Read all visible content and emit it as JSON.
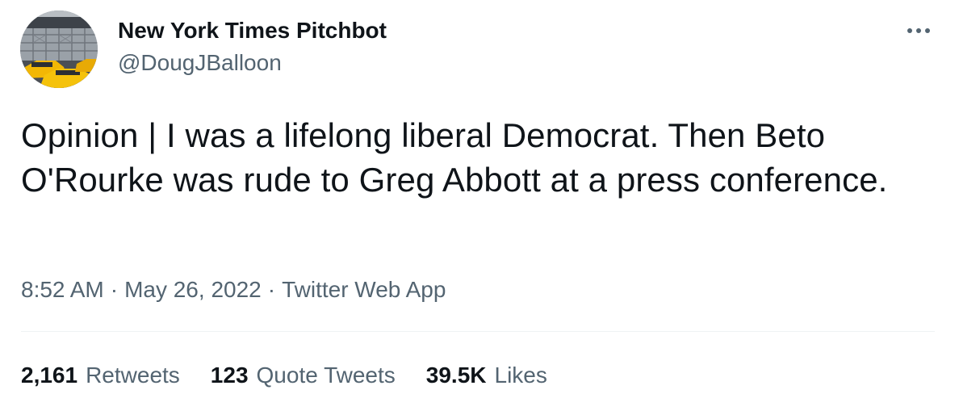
{
  "tweet": {
    "author": {
      "name": "New York Times Pitchbot",
      "handle": "@DougJBalloon",
      "avatar_masthead": "The New York Times"
    },
    "text": "Opinion | I was a lifelong liberal Democrat.  Then Beto O'Rourke was rude to Greg Abbott at a press conference.",
    "meta": {
      "time": "8:52 AM",
      "date": "May 26, 2022",
      "source": "Twitter Web App",
      "separator": "·"
    },
    "stats": {
      "retweets": {
        "count": "2,161",
        "label": "Retweets"
      },
      "quote_tweets": {
        "count": "123",
        "label": "Quote Tweets"
      },
      "likes": {
        "count": "39.5K",
        "label": "Likes"
      }
    },
    "more_icon": "more-horizontal-icon"
  },
  "colors": {
    "text_primary": "#0f1419",
    "text_secondary": "#536471",
    "divider": "#eff3f4"
  }
}
